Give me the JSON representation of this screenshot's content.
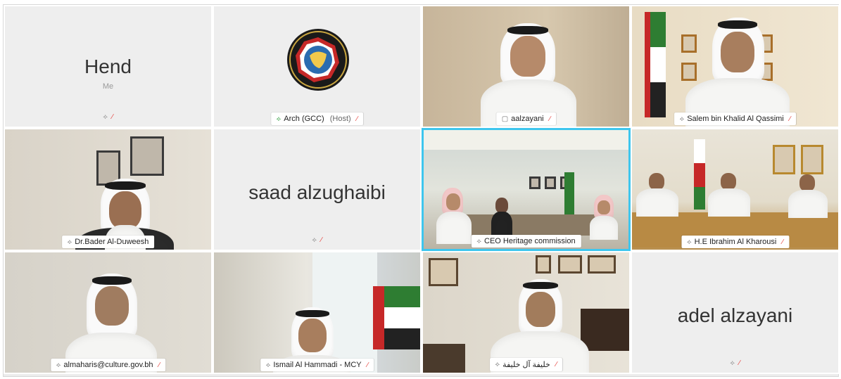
{
  "tiles": [
    {
      "name": "Hend",
      "sub": "Me"
    },
    {
      "name": "Arch (GCC)",
      "host": "(Host)"
    },
    {
      "name": "aalzayani"
    },
    {
      "name": "Salem bin Khalid Al Qassimi"
    },
    {
      "name": "Dr.Bader Al-Duweesh"
    },
    {
      "name": "saad alzughaibi"
    },
    {
      "name": "CEO Heritage commission"
    },
    {
      "name": "H.E Ibrahim Al Kharousi"
    },
    {
      "name": "almaharis@culture.gov.bh"
    },
    {
      "name": "Ismail Al Hammadi - MCY"
    },
    {
      "name": "خليفة آل خليفة"
    },
    {
      "name": "adel alzayani"
    }
  ],
  "icons": {
    "pin": "pin-icon",
    "mic_off": "mic-off-icon",
    "gcc_logo": "gcc-logo-icon"
  },
  "colors": {
    "active_speaker_border": "#3ec6ee",
    "mic_off": "#e53935",
    "tile_bg": "#eeeeee"
  }
}
